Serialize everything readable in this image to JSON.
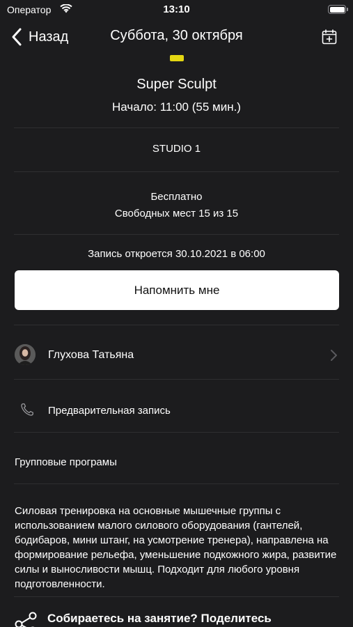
{
  "status_bar": {
    "carrier": "Оператор",
    "time": "13:10"
  },
  "nav": {
    "back_label": "Назад",
    "title": "Суббота, 30 октября"
  },
  "class": {
    "title": "Super Sculpt",
    "start": "Начало: 11:00 (55 мин.)",
    "studio": "STUDIO 1",
    "price": "Бесплатно",
    "seats": "Свободных мест 15 из 15",
    "booking_opens": "Запись откроется 30.10.2021 в 06:00"
  },
  "remind_button": {
    "label": "Напомнить мне"
  },
  "trainer": {
    "name": "Глухова Татьяна"
  },
  "phone": {
    "label": "Предварительная запись"
  },
  "category": "Групповые програмы",
  "description": "Силовая тренировка на основные мышечные группы с использованием малого силового оборудования (гантелей, бодибаров, мини штанг, на усмотрение тренера), направлена на формирование рельефа, уменьшение подкожного жира, развитие силы и выносливости мышц. Подходит для любого уровня подготовленности.",
  "share": {
    "label": "Собираетесь на занятие? Поделитесь"
  },
  "colors": {
    "background": "#1c1c1e",
    "accent": "#e4d712",
    "button_bg": "#ffffff"
  }
}
